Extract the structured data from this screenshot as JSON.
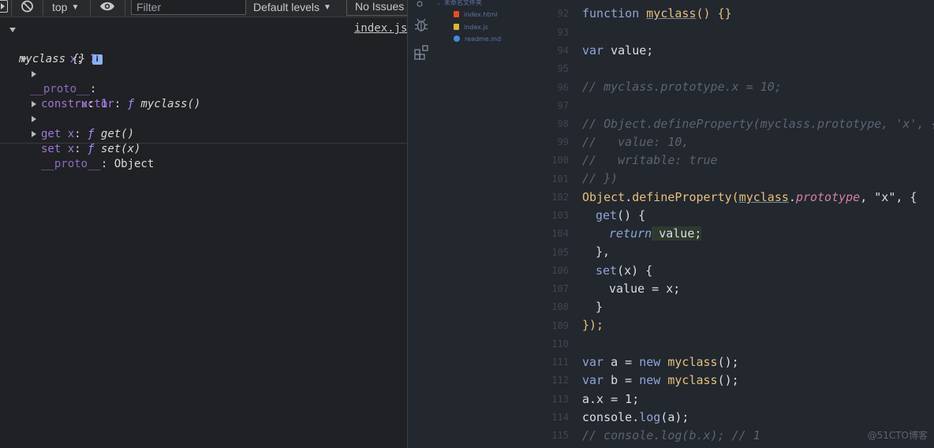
{
  "console": {
    "toolbar": {
      "context": "top",
      "filter_placeholder": "Filter",
      "levels": "Default levels",
      "issues": "No Issues"
    },
    "source_link": "index.js",
    "tree": {
      "root_name": "myclass {}",
      "badge": "i",
      "x_key": "x",
      "x_value": "1",
      "proto_key": "__proto__",
      "constructor_key": "constructor",
      "constructor_f": "ƒ",
      "constructor_value": "myclass()",
      "proto_x_key": "x",
      "proto_x_value": "1",
      "get_label": "get x",
      "get_f": "ƒ",
      "get_value": "get()",
      "set_label": "set x",
      "set_f": "ƒ",
      "set_value": "set(x)",
      "inner_proto_key": "__proto__",
      "inner_proto_value": "Object"
    }
  },
  "editor": {
    "explorer": {
      "folder": "未命名文件夹",
      "files": [
        "index.html",
        "index.js",
        "readme.md"
      ]
    },
    "line_numbers": [
      "92",
      "93",
      "94",
      "95",
      "96",
      "97",
      "98",
      "99",
      "100",
      "101",
      "102",
      "103",
      "104",
      "105",
      "106",
      "107",
      "108",
      "109",
      "110",
      "111",
      "112",
      "113",
      "114",
      "115"
    ],
    "code": {
      "l92": {
        "kw": "function",
        "fn": "myclass",
        "rest": "() {}"
      },
      "l94": {
        "kw": "var",
        "rest": " value;"
      },
      "l96": "// myclass.prototype.x = 10;",
      "l98": "// Object.defineProperty(myclass.prototype, 'x', {",
      "l99": "//   value: 10,",
      "l100": "//   writable: true",
      "l101": "// })",
      "l102": {
        "obj": "Object",
        "dot": ".",
        "method": "defineProperty",
        "p1": "(",
        "cls": "myclass",
        "dot2": ".",
        "prop": "prototype",
        "rest": ", \"x\", {"
      },
      "l103": {
        "kw": "get",
        "rest": "() {"
      },
      "l104": {
        "kw": "return",
        "rest": " value;"
      },
      "l105": "},",
      "l106": {
        "kw": "set",
        "rest": "(x) {"
      },
      "l107": "value = x;",
      "l108": "}",
      "l109": "});",
      "l111": {
        "kw": "var",
        "a": " a = ",
        "kw2": "new",
        "fn": " myclass",
        "rest": "();"
      },
      "l112": {
        "kw": "var",
        "a": " b = ",
        "kw2": "new",
        "fn": " myclass",
        "rest": "();"
      },
      "l113": "a.x = 1;",
      "l114": {
        "obj": "console",
        "dot": ".",
        "method": "log",
        "rest": "(a);"
      },
      "l115": "// console.log(b.x); // 1"
    },
    "watermark": "@51CTO博客"
  }
}
